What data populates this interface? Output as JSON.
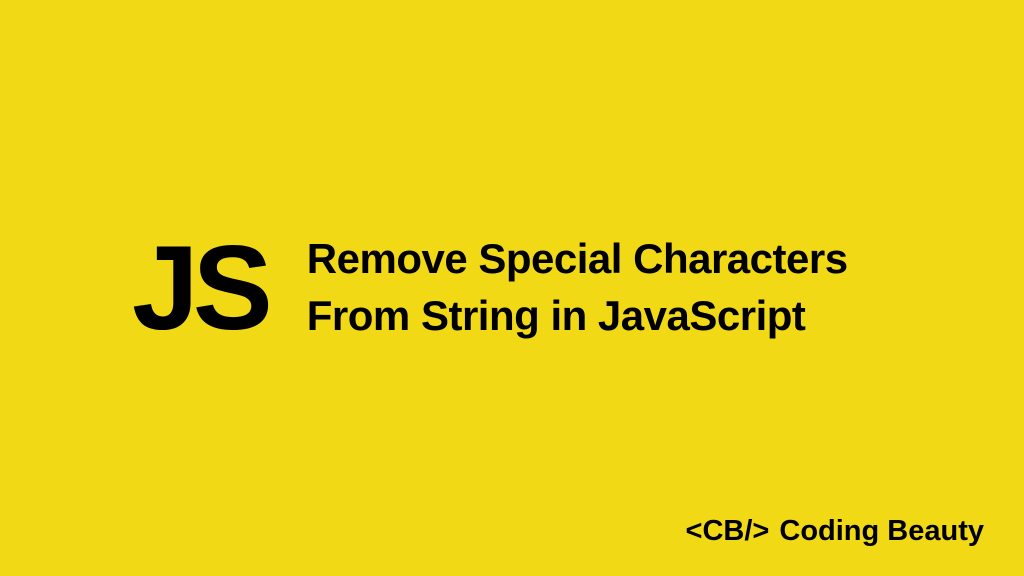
{
  "logo": "JS",
  "title": "Remove Special Characters From String in JavaScript",
  "footer": {
    "tag": "<CB/>",
    "brand": "Coding Beauty"
  }
}
